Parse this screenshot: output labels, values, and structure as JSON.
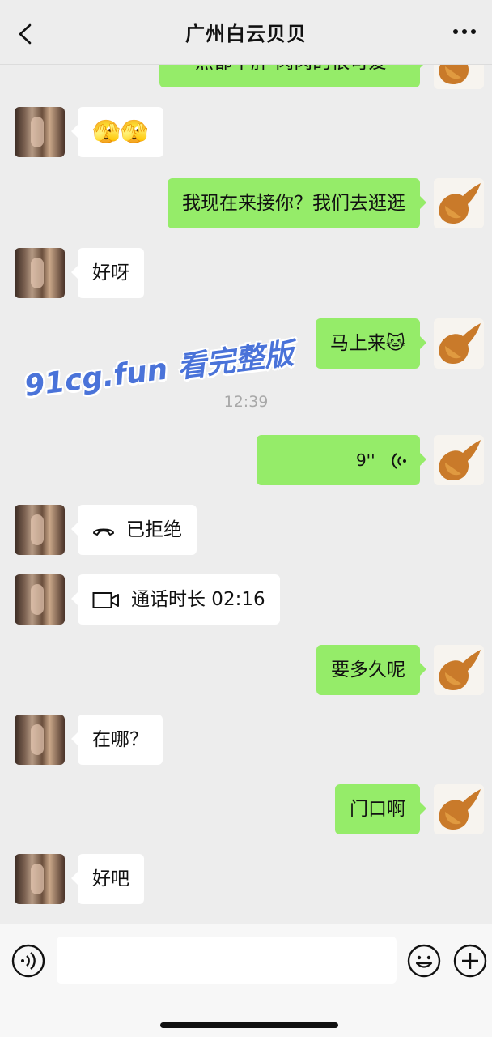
{
  "header": {
    "title": "广州白云贝贝",
    "back_icon": "chevron-left-icon",
    "more_icon": "more-dots-icon"
  },
  "messages": {
    "m0": "点都不胖 肉肉的很可爱",
    "m1_emoji": "🫣🫣",
    "m2": "我现在来接你？我们去逛逛",
    "m3": "好呀",
    "m4": "马上来",
    "m4_emoji": "🐱",
    "timestamp": "12:39",
    "m5_duration": "9''",
    "m6": "已拒绝",
    "m7": "通话时长 02:16",
    "m8": "要多久呢",
    "m9": "在哪？",
    "m10": "门口啊",
    "m11": "好吧"
  },
  "watermark": "91cg.fun 看完整版",
  "footer": {
    "input_value": "",
    "voice_icon": "voice-icon",
    "emoji_icon": "emoji-icon",
    "plus_icon": "plus-icon"
  },
  "colors": {
    "background": "#ededed",
    "bubble_sent": "#95ec69",
    "bubble_received": "#ffffff",
    "watermark": "#4a73d9"
  }
}
